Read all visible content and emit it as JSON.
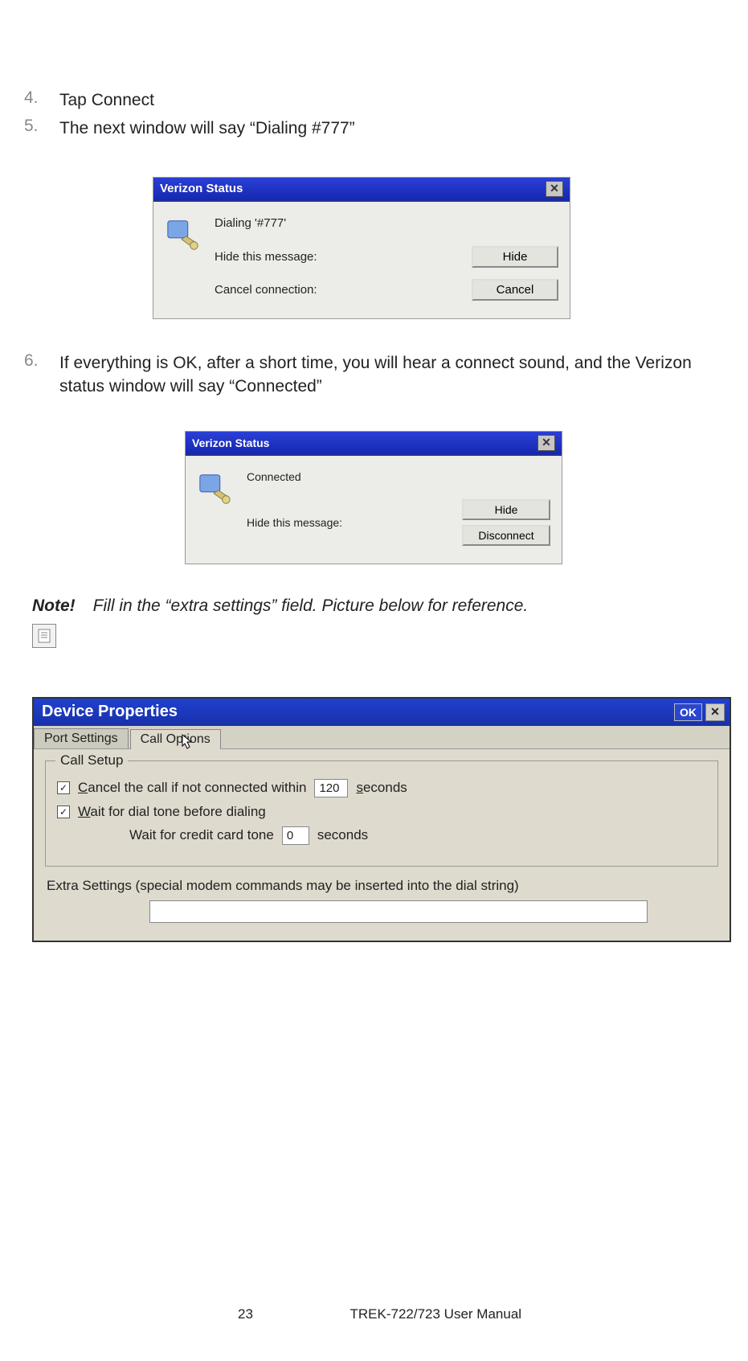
{
  "list": {
    "item4": {
      "num": "4.",
      "text": "Tap Connect"
    },
    "item5": {
      "num": "5.",
      "text": "The next window will say “Dialing #777”"
    },
    "item6": {
      "num": "6.",
      "text": "If everything is OK, after a short time, you will hear a connect sound, and the Verizon status window will say “Connected”"
    }
  },
  "win1": {
    "title": "Verizon Status",
    "status": "Dialing '#777'",
    "hide_label": "Hide this message:",
    "cancel_label": "Cancel connection:",
    "hide_btn": "Hide",
    "cancel_btn": "Cancel"
  },
  "win2": {
    "title": "Verizon Status",
    "status": "Connected",
    "hide_label": "Hide this message:",
    "hide_btn": "Hide",
    "disconnect_btn": "Disconnect"
  },
  "note": {
    "label": "Note!",
    "text": "Fill in the “extra settings” field. Picture below for reference."
  },
  "dp": {
    "title": "Device Properties",
    "ok": "OK",
    "tabs": {
      "port": "Port Settings",
      "call": "Call Options"
    },
    "group_title": "Call Setup",
    "cancel_call_prefix": "C",
    "cancel_call_rest": "ancel the call if not connected within",
    "cancel_call_value": "120",
    "cancel_call_unit_prefix": "s",
    "cancel_call_unit_rest": "econds",
    "wait_tone_prefix": "W",
    "wait_tone_rest": "ait for dial tone before dialing",
    "wait_credit": "Wait for credit card tone",
    "wait_credit_value": "0",
    "seconds": "seconds",
    "extra_label": "Extra Settings (special modem commands may be inserted into the dial string)"
  },
  "footer": {
    "page": "23",
    "manual": "TREK-722/723 User Manual"
  }
}
